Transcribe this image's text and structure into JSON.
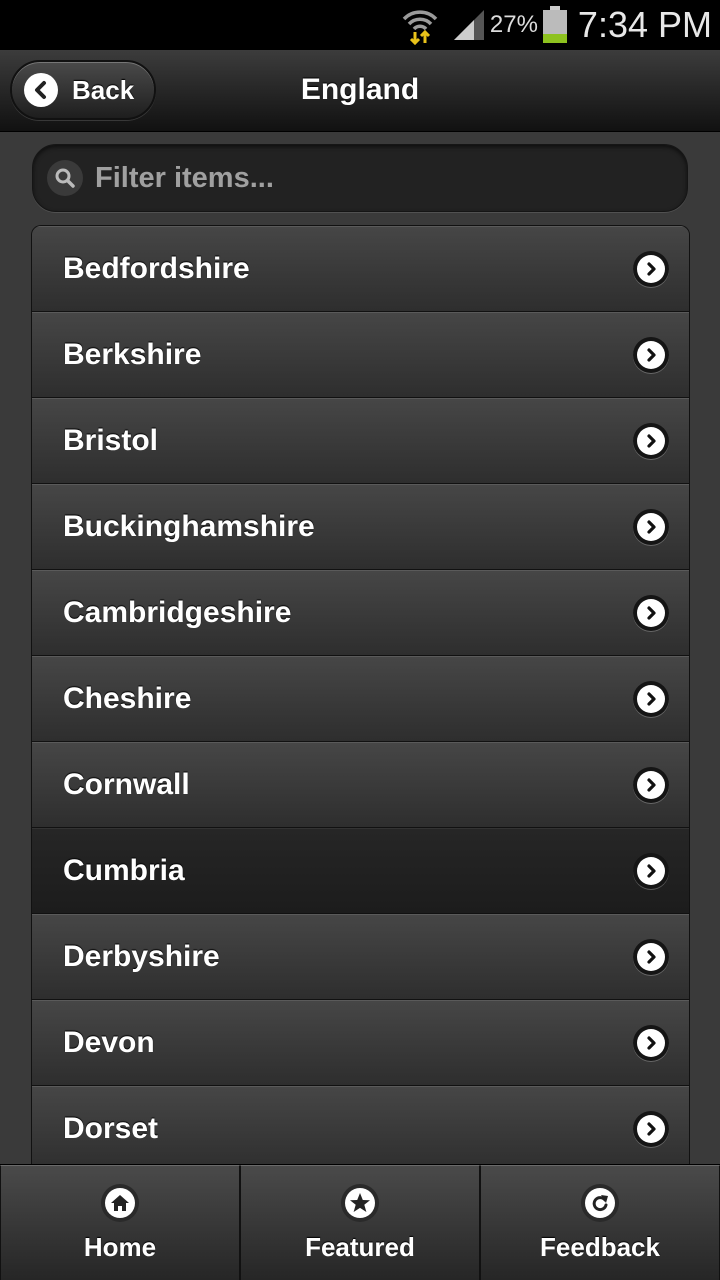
{
  "status_bar": {
    "battery_percent": "27%",
    "time": "7:34 PM",
    "icons": [
      "wifi-icon",
      "signal-icon",
      "battery-icon"
    ]
  },
  "header": {
    "back_label": "Back",
    "title": "England"
  },
  "search": {
    "placeholder": "Filter items..."
  },
  "list": {
    "items": [
      {
        "label": "Bedfordshire"
      },
      {
        "label": "Berkshire"
      },
      {
        "label": "Bristol"
      },
      {
        "label": "Buckinghamshire"
      },
      {
        "label": "Cambridgeshire"
      },
      {
        "label": "Cheshire"
      },
      {
        "label": "Cornwall"
      },
      {
        "label": "Cumbria"
      },
      {
        "label": "Derbyshire"
      },
      {
        "label": "Devon"
      },
      {
        "label": "Dorset"
      }
    ],
    "active_index": 7
  },
  "tabbar": {
    "tabs": [
      {
        "label": "Home",
        "icon": "home-icon"
      },
      {
        "label": "Featured",
        "icon": "star-icon"
      },
      {
        "label": "Feedback",
        "icon": "refresh-icon"
      }
    ]
  },
  "colors": {
    "background": "#3a3a3a",
    "status_bar": "#000000",
    "battery_fill": "#8ec21f",
    "wifi_arrows": "#e8c21a"
  }
}
